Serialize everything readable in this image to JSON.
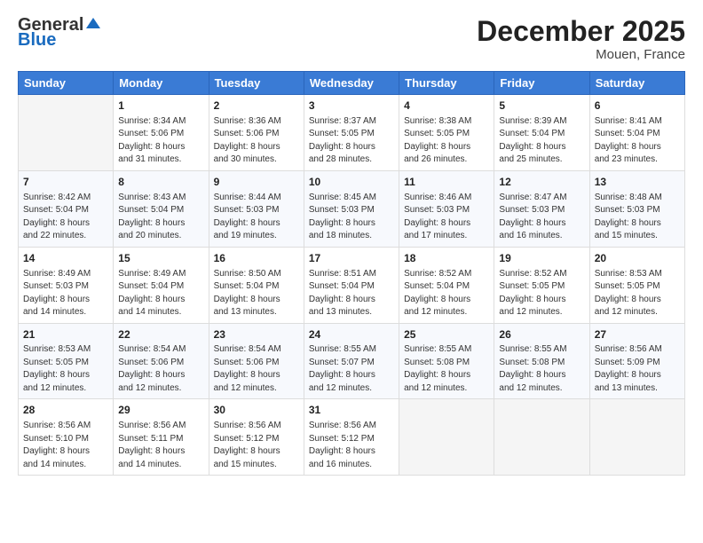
{
  "logo": {
    "general": "General",
    "blue": "Blue"
  },
  "title": "December 2025",
  "location": "Mouen, France",
  "headers": [
    "Sunday",
    "Monday",
    "Tuesday",
    "Wednesday",
    "Thursday",
    "Friday",
    "Saturday"
  ],
  "weeks": [
    [
      {
        "day": "",
        "info": ""
      },
      {
        "day": "1",
        "info": "Sunrise: 8:34 AM\nSunset: 5:06 PM\nDaylight: 8 hours\nand 31 minutes."
      },
      {
        "day": "2",
        "info": "Sunrise: 8:36 AM\nSunset: 5:06 PM\nDaylight: 8 hours\nand 30 minutes."
      },
      {
        "day": "3",
        "info": "Sunrise: 8:37 AM\nSunset: 5:05 PM\nDaylight: 8 hours\nand 28 minutes."
      },
      {
        "day": "4",
        "info": "Sunrise: 8:38 AM\nSunset: 5:05 PM\nDaylight: 8 hours\nand 26 minutes."
      },
      {
        "day": "5",
        "info": "Sunrise: 8:39 AM\nSunset: 5:04 PM\nDaylight: 8 hours\nand 25 minutes."
      },
      {
        "day": "6",
        "info": "Sunrise: 8:41 AM\nSunset: 5:04 PM\nDaylight: 8 hours\nand 23 minutes."
      }
    ],
    [
      {
        "day": "7",
        "info": "Sunrise: 8:42 AM\nSunset: 5:04 PM\nDaylight: 8 hours\nand 22 minutes."
      },
      {
        "day": "8",
        "info": "Sunrise: 8:43 AM\nSunset: 5:04 PM\nDaylight: 8 hours\nand 20 minutes."
      },
      {
        "day": "9",
        "info": "Sunrise: 8:44 AM\nSunset: 5:03 PM\nDaylight: 8 hours\nand 19 minutes."
      },
      {
        "day": "10",
        "info": "Sunrise: 8:45 AM\nSunset: 5:03 PM\nDaylight: 8 hours\nand 18 minutes."
      },
      {
        "day": "11",
        "info": "Sunrise: 8:46 AM\nSunset: 5:03 PM\nDaylight: 8 hours\nand 17 minutes."
      },
      {
        "day": "12",
        "info": "Sunrise: 8:47 AM\nSunset: 5:03 PM\nDaylight: 8 hours\nand 16 minutes."
      },
      {
        "day": "13",
        "info": "Sunrise: 8:48 AM\nSunset: 5:03 PM\nDaylight: 8 hours\nand 15 minutes."
      }
    ],
    [
      {
        "day": "14",
        "info": "Sunrise: 8:49 AM\nSunset: 5:03 PM\nDaylight: 8 hours\nand 14 minutes."
      },
      {
        "day": "15",
        "info": "Sunrise: 8:49 AM\nSunset: 5:04 PM\nDaylight: 8 hours\nand 14 minutes."
      },
      {
        "day": "16",
        "info": "Sunrise: 8:50 AM\nSunset: 5:04 PM\nDaylight: 8 hours\nand 13 minutes."
      },
      {
        "day": "17",
        "info": "Sunrise: 8:51 AM\nSunset: 5:04 PM\nDaylight: 8 hours\nand 13 minutes."
      },
      {
        "day": "18",
        "info": "Sunrise: 8:52 AM\nSunset: 5:04 PM\nDaylight: 8 hours\nand 12 minutes."
      },
      {
        "day": "19",
        "info": "Sunrise: 8:52 AM\nSunset: 5:05 PM\nDaylight: 8 hours\nand 12 minutes."
      },
      {
        "day": "20",
        "info": "Sunrise: 8:53 AM\nSunset: 5:05 PM\nDaylight: 8 hours\nand 12 minutes."
      }
    ],
    [
      {
        "day": "21",
        "info": "Sunrise: 8:53 AM\nSunset: 5:05 PM\nDaylight: 8 hours\nand 12 minutes."
      },
      {
        "day": "22",
        "info": "Sunrise: 8:54 AM\nSunset: 5:06 PM\nDaylight: 8 hours\nand 12 minutes."
      },
      {
        "day": "23",
        "info": "Sunrise: 8:54 AM\nSunset: 5:06 PM\nDaylight: 8 hours\nand 12 minutes."
      },
      {
        "day": "24",
        "info": "Sunrise: 8:55 AM\nSunset: 5:07 PM\nDaylight: 8 hours\nand 12 minutes."
      },
      {
        "day": "25",
        "info": "Sunrise: 8:55 AM\nSunset: 5:08 PM\nDaylight: 8 hours\nand 12 minutes."
      },
      {
        "day": "26",
        "info": "Sunrise: 8:55 AM\nSunset: 5:08 PM\nDaylight: 8 hours\nand 12 minutes."
      },
      {
        "day": "27",
        "info": "Sunrise: 8:56 AM\nSunset: 5:09 PM\nDaylight: 8 hours\nand 13 minutes."
      }
    ],
    [
      {
        "day": "28",
        "info": "Sunrise: 8:56 AM\nSunset: 5:10 PM\nDaylight: 8 hours\nand 14 minutes."
      },
      {
        "day": "29",
        "info": "Sunrise: 8:56 AM\nSunset: 5:11 PM\nDaylight: 8 hours\nand 14 minutes."
      },
      {
        "day": "30",
        "info": "Sunrise: 8:56 AM\nSunset: 5:12 PM\nDaylight: 8 hours\nand 15 minutes."
      },
      {
        "day": "31",
        "info": "Sunrise: 8:56 AM\nSunset: 5:12 PM\nDaylight: 8 hours\nand 16 minutes."
      },
      {
        "day": "",
        "info": ""
      },
      {
        "day": "",
        "info": ""
      },
      {
        "day": "",
        "info": ""
      }
    ]
  ]
}
